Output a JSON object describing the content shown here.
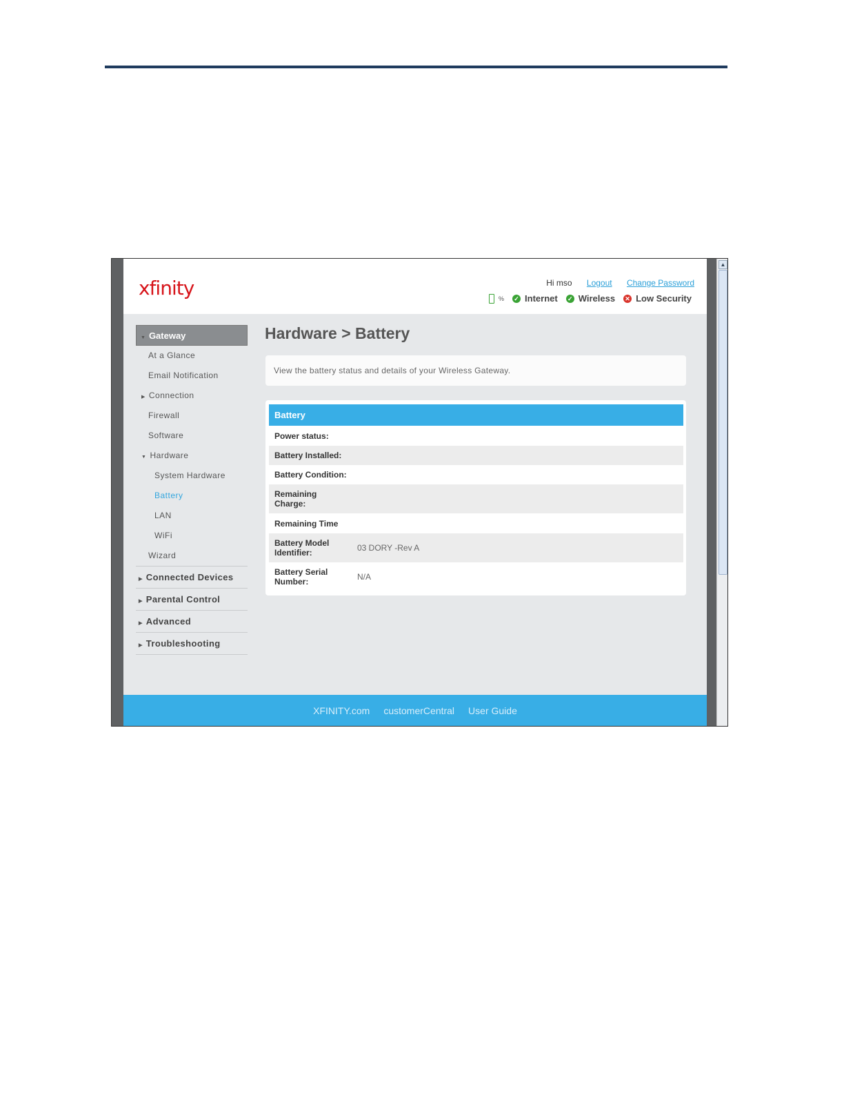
{
  "header": {
    "logo": "xfinity",
    "greeting": "Hi mso",
    "logout": "Logout",
    "change_password": "Change Password",
    "battery_pct": "%",
    "status": {
      "internet": "Internet",
      "wireless": "Wireless",
      "security": "Low Security"
    }
  },
  "sidebar": {
    "gateway": "Gateway",
    "items": {
      "at_a_glance": "At a Glance",
      "email_notification": "Email Notification",
      "connection": "Connection",
      "firewall": "Firewall",
      "software": "Software",
      "hardware": "Hardware",
      "system_hardware": "System Hardware",
      "battery": "Battery",
      "lan": "LAN",
      "wifi": "WiFi",
      "wizard": "Wizard"
    },
    "sections": {
      "connected_devices": "Connected Devices",
      "parental_control": "Parental Control",
      "advanced": "Advanced",
      "troubleshooting": "Troubleshooting"
    }
  },
  "main": {
    "title": "Hardware > Battery",
    "description": "View the battery status and details of your Wireless Gateway.",
    "panel_title": "Battery",
    "rows": [
      {
        "label": "Power status:",
        "value": ""
      },
      {
        "label": "Battery Installed:",
        "value": ""
      },
      {
        "label": "Battery Condition:",
        "value": ""
      },
      {
        "label": "Remaining Charge:",
        "value": ""
      },
      {
        "label": "Remaining Time",
        "value": ""
      },
      {
        "label": "Battery Model Identifier:",
        "value": "03 DORY -Rev A"
      },
      {
        "label": "Battery Serial Number:",
        "value": "N/A"
      }
    ]
  },
  "footer": {
    "links": [
      "XFINITY.com",
      "customerCentral",
      "User Guide"
    ]
  },
  "colors": {
    "accent": "#38aee6",
    "logo_red": "#d7141a",
    "ok_green": "#3aa335",
    "alert_red": "#d9342b"
  }
}
